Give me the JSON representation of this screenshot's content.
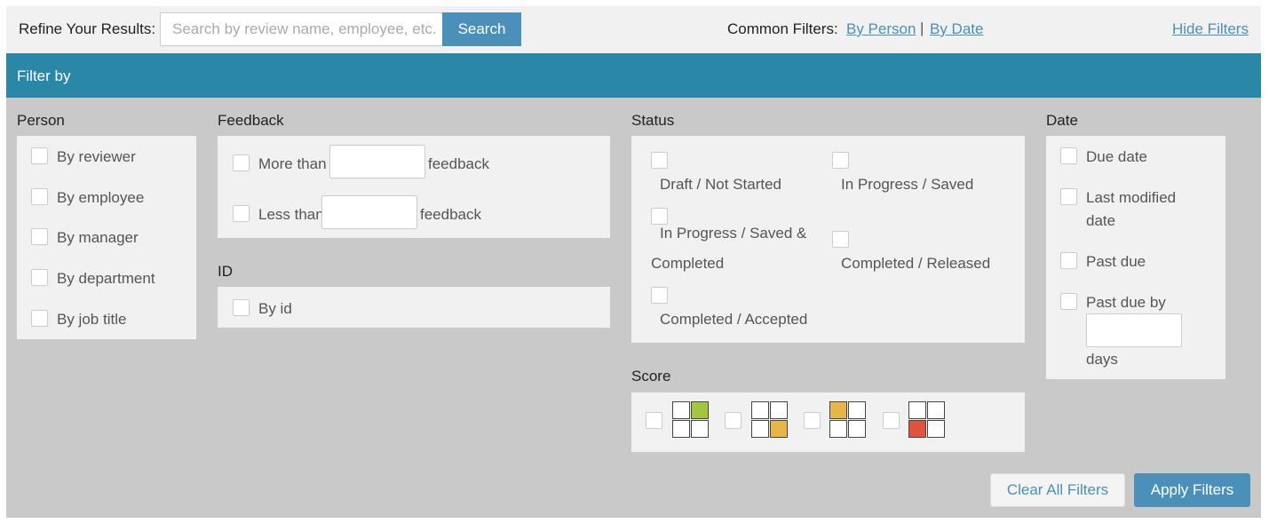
{
  "topbar": {
    "refine_label": "Refine Your Results:",
    "search_placeholder": "Search by review name, employee, etc.",
    "search_button": "Search",
    "common_filters_label": "Common Filters:",
    "by_person_link": "By Person",
    "separator": "|",
    "by_date_link": "By Date",
    "hide_filters_link": "Hide Filters"
  },
  "filter_header": {
    "title": "Filter by"
  },
  "person": {
    "title": "Person",
    "options": [
      "By reviewer",
      "By employee",
      "By manager",
      "By department",
      "By job title"
    ]
  },
  "feedback": {
    "title": "Feedback",
    "more_than": "More than",
    "less_than": "Less than",
    "suffix": "feedback"
  },
  "id_section": {
    "title": "ID",
    "by_id": "By id"
  },
  "status": {
    "title": "Status",
    "draft": "Draft / Not Started",
    "in_progress_saved": "In Progress / Saved",
    "in_progress_completed_line1": "In Progress / Saved &",
    "in_progress_completed_line2": "Completed",
    "completed_released": "Completed / Released",
    "completed_accepted": "Completed / Accepted"
  },
  "score": {
    "title": "Score",
    "colors": {
      "green": "#a3c63f",
      "yellow": "#e8b54a",
      "red": "#e0533c"
    }
  },
  "date": {
    "title": "Date",
    "due_date": "Due date",
    "last_modified_line1": "Last modified",
    "last_modified_line2": "date",
    "past_due": "Past due",
    "past_due_by": "Past due by",
    "days": "days"
  },
  "actions": {
    "clear": "Clear All Filters",
    "apply": "Apply Filters"
  }
}
